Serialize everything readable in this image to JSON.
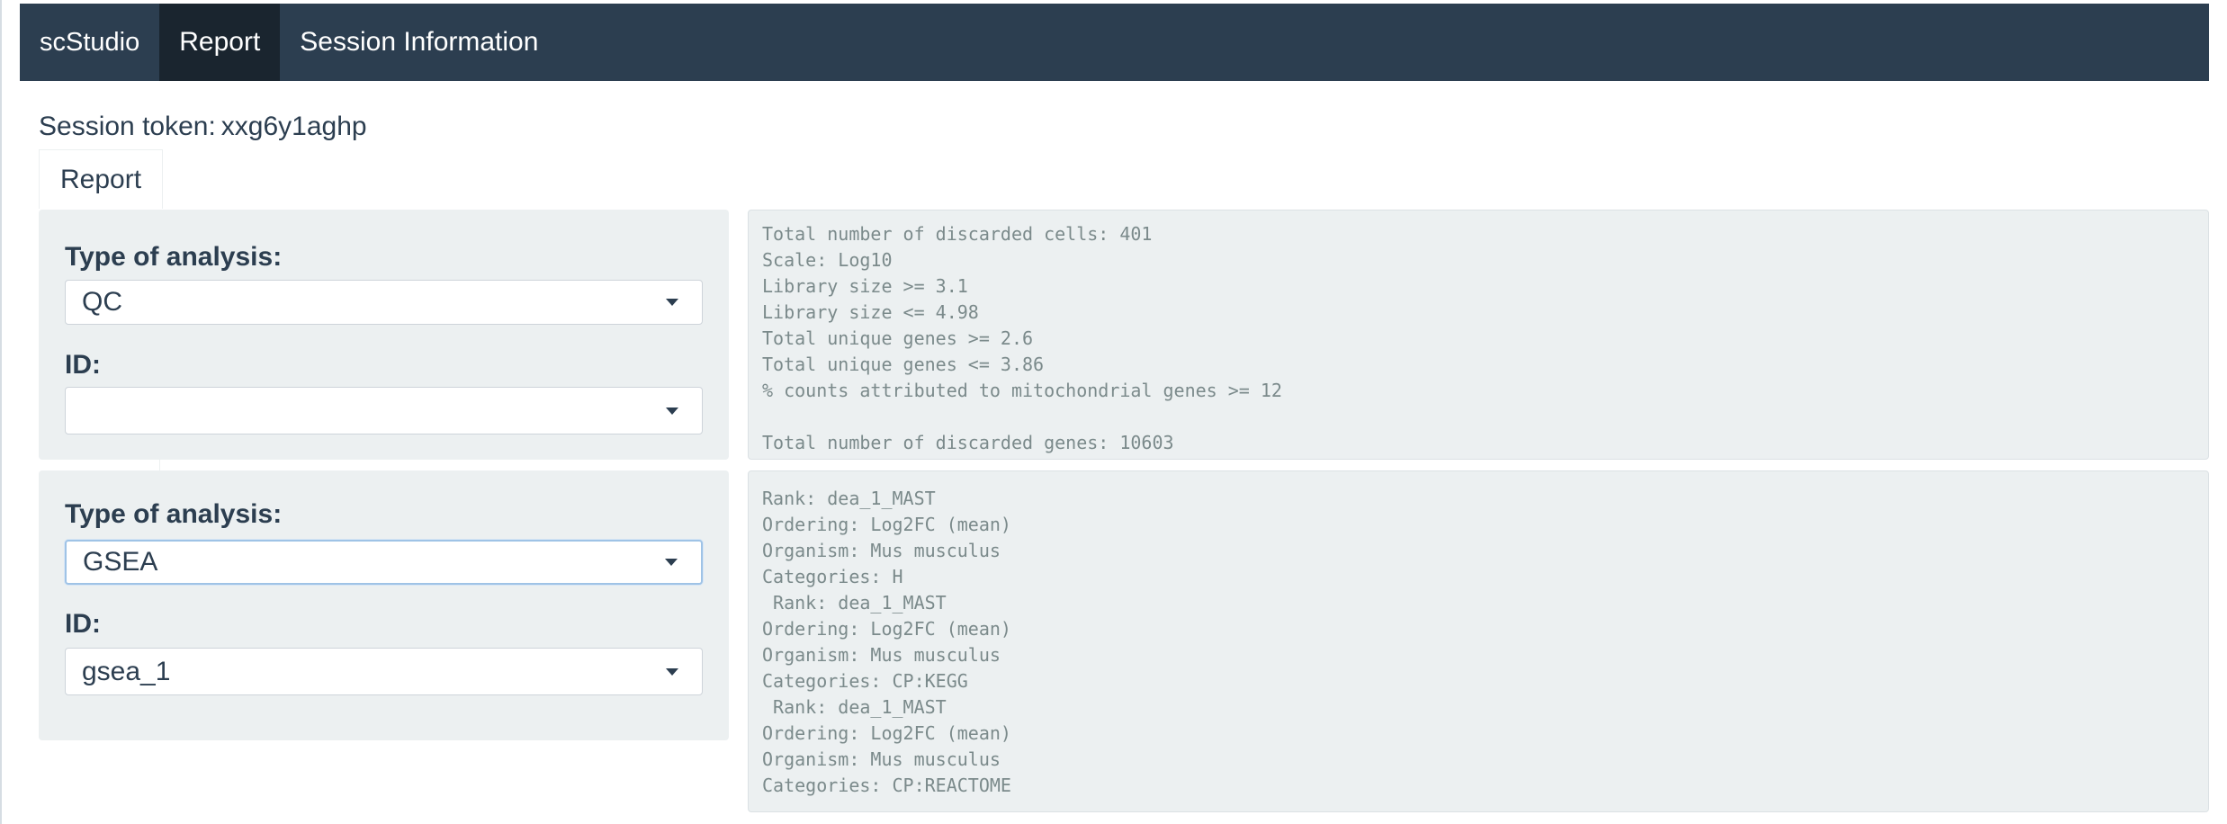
{
  "navbar": {
    "brand": "scStudio",
    "items": [
      {
        "label": "Report",
        "active": true
      },
      {
        "label": "Session Information",
        "active": false
      }
    ]
  },
  "session": {
    "label": "Session token:",
    "token": "xxg6y1aghp"
  },
  "tabs": [
    {
      "label": "Report",
      "active": true
    }
  ],
  "panels": [
    {
      "analysis_label": "Type of analysis:",
      "analysis_value": "QC",
      "id_label": "ID:",
      "id_value": "",
      "output_lines": [
        "Total number of discarded cells: 401",
        "Scale: Log10",
        "Library size >= 3.1",
        "Library size <= 4.98",
        "Total unique genes >= 2.6",
        "Total unique genes <= 3.86",
        "% counts attributed to mitochondrial genes >= 12",
        "",
        "Total number of discarded genes: 10603"
      ]
    },
    {
      "analysis_label": "Type of analysis:",
      "analysis_value": "GSEA",
      "id_label": "ID:",
      "id_value": "gsea_1",
      "output_lines": [
        "Rank: dea_1_MAST",
        "Ordering: Log2FC (mean)",
        "Organism: Mus musculus",
        "Categories: H",
        " Rank: dea_1_MAST",
        "Ordering: Log2FC (mean)",
        "Organism: Mus musculus",
        "Categories: CP:KEGG",
        " Rank: dea_1_MAST",
        "Ordering: Log2FC (mean)",
        "Organism: Mus musculus",
        "Categories: CP:REACTOME"
      ]
    }
  ],
  "colors": {
    "navbar_bg": "#2c3e50",
    "navbar_active_bg": "#1a252f",
    "panel_bg": "#ecf0f1",
    "text_primary": "#2c3e50",
    "output_text": "#7b8a8b",
    "focus_border": "#9fc3e6"
  },
  "icons": {
    "select_caret": "chevron-down-icon"
  }
}
